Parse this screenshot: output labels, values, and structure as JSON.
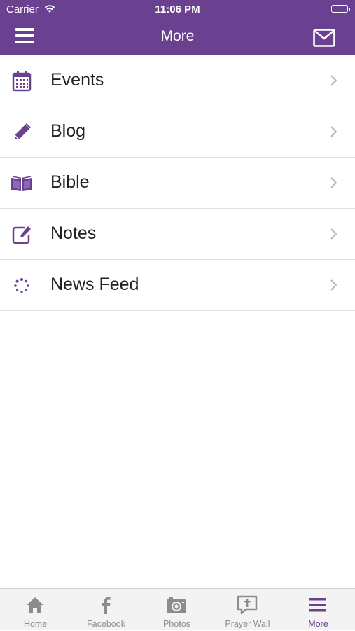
{
  "status_bar": {
    "carrier": "Carrier",
    "time": "11:06 PM"
  },
  "navbar": {
    "title": "More",
    "left_icon": "hamburger-menu-icon",
    "right_icon": "envelope-icon"
  },
  "menu": {
    "items": [
      {
        "label": "Events",
        "icon": "calendar-icon"
      },
      {
        "label": "Blog",
        "icon": "pencil-icon"
      },
      {
        "label": "Bible",
        "icon": "open-book-icon"
      },
      {
        "label": "Notes",
        "icon": "edit-note-icon"
      },
      {
        "label": "News Feed",
        "icon": "refresh-icon"
      }
    ]
  },
  "tabbar": {
    "tabs": [
      {
        "label": "Home",
        "icon": "home-icon"
      },
      {
        "label": "Facebook",
        "icon": "facebook-icon"
      },
      {
        "label": "Photos",
        "icon": "camera-icon"
      },
      {
        "label": "Prayer Wall",
        "icon": "prayer-wall-icon"
      },
      {
        "label": "More",
        "icon": "hamburger-menu-icon"
      }
    ],
    "active": "More"
  },
  "colors": {
    "brand": "#6a4190",
    "tab_inactive": "#8c8c8c"
  }
}
